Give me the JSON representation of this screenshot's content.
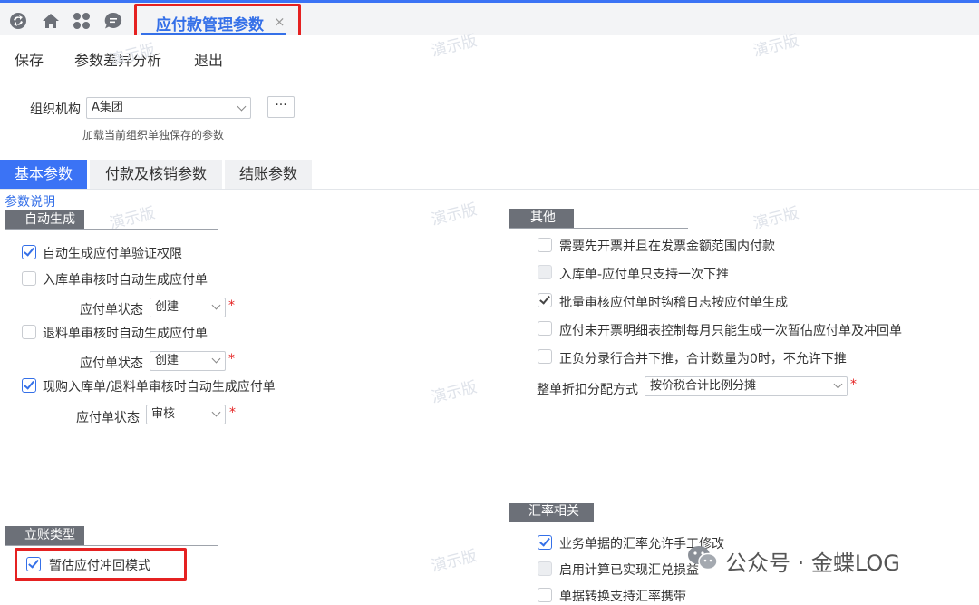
{
  "header": {
    "tab_title": "应付款管理参数",
    "close_glyph": "×",
    "icons": [
      "refresh-icon",
      "home-icon",
      "apps-grid-icon",
      "chat-icon"
    ]
  },
  "toolbar": {
    "save": "保存",
    "diff": "参数差异分析",
    "exit": "退出"
  },
  "org": {
    "label": "组织机构",
    "value": "A集团",
    "more": "···",
    "hint": "加载当前组织单独保存的参数"
  },
  "tabs": [
    "基本参数",
    "付款及核销参数",
    "结账参数"
  ],
  "param_desc": "参数说明",
  "left": {
    "auto_title": "自动生成",
    "items": [
      {
        "label": "自动生成应付单验证权限",
        "checked": true
      },
      {
        "label": "入库单审核时自动生成应付单",
        "checked": false
      },
      {
        "label": "退料单审核时自动生成应付单",
        "checked": false
      },
      {
        "label": "现购入库单/退料单审核时自动生成应付单",
        "checked": true
      }
    ],
    "status_label": "应付单状态",
    "status_values": [
      "创建",
      "创建",
      "审核"
    ],
    "required": "*",
    "account_title": "立账类型",
    "account_item": {
      "label": "暂估应付冲回模式",
      "checked": true
    }
  },
  "right": {
    "other_title": "其他",
    "items": [
      {
        "label": "需要先开票并且在发票金额范围内付款",
        "checked": false
      },
      {
        "label": "入库单-应付单只支持一次下推",
        "checked": false
      },
      {
        "label": "批量审核应付单时钩稽日志按应付单生成",
        "checked": true
      },
      {
        "label": "应付未开票明细表控制每月只能生成一次暂估应付单及冲回单",
        "checked": false
      },
      {
        "label": "正负分录行合并下推，合计数量为0时，不允许下推",
        "checked": false
      }
    ],
    "discount_label": "整单折扣分配方式",
    "discount_value": "按价税合计比例分摊",
    "fx_title": "汇率相关",
    "fx_items": [
      {
        "label": "业务单据的汇率允许手工修改",
        "checked": true
      },
      {
        "label": "启用计算已实现汇兑损益",
        "checked": false
      },
      {
        "label": "单据转换支持汇率携带",
        "checked": false
      }
    ]
  },
  "watermark_text": "演示版",
  "brand": "公众号 · 金蝶LOG"
}
